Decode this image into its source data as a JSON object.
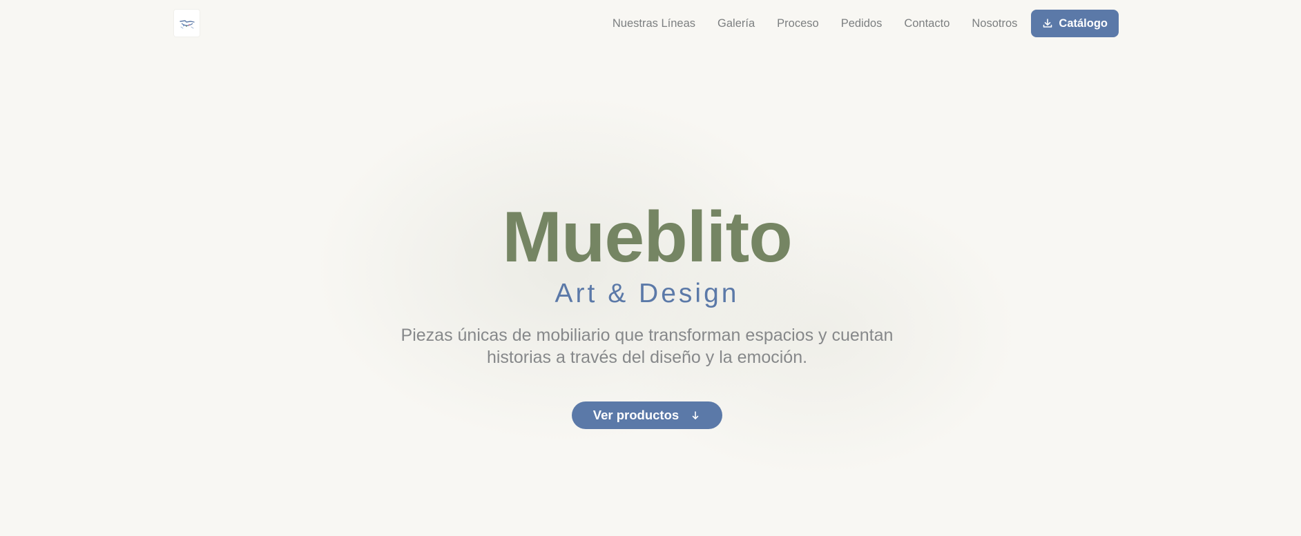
{
  "header": {
    "logo_icon": "mueblito-logo",
    "nav": [
      {
        "label": "Nuestras Líneas"
      },
      {
        "label": "Galería"
      },
      {
        "label": "Proceso"
      },
      {
        "label": "Pedidos"
      },
      {
        "label": "Contacto"
      },
      {
        "label": "Nosotros"
      }
    ],
    "catalog_button": {
      "label": "Catálogo",
      "icon": "download-icon"
    }
  },
  "hero": {
    "title": "Mueblito",
    "subtitle": "Art & Design",
    "description": "Piezas únicas de mobiliario que transforman espacios y cuentan historias a través del diseño y la emoción.",
    "cta": {
      "label": "Ver productos",
      "icon": "arrow-down-icon"
    }
  },
  "colors": {
    "background": "#f8f7f3",
    "brand_green": "#758563",
    "brand_blue": "#5b79a8",
    "text_muted": "#86888a"
  }
}
